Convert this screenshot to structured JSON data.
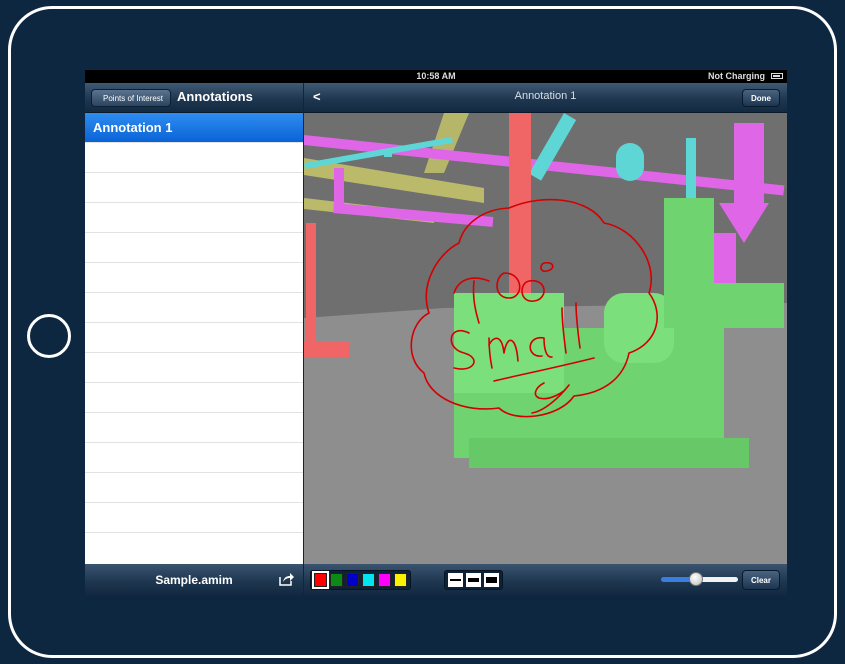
{
  "status": {
    "time": "10:58 AM",
    "charging": "Not Charging"
  },
  "master": {
    "back_label": "Points of Interest",
    "title": "Annotations",
    "items": [
      {
        "label": "Annotation 1",
        "selected": true
      }
    ],
    "empty_rows": 13,
    "file_name": "Sample.amim"
  },
  "detail": {
    "back_label": "<",
    "title": "Annotation 1",
    "done_label": "Done",
    "annotation_text": "Too small"
  },
  "toolbar": {
    "colors": [
      "#ff0000",
      "#0b8a16",
      "#0000c8",
      "#00e5f0",
      "#ff00ff",
      "#f8f200"
    ],
    "selected_color": "#ff0000",
    "line_widths": [
      "thin",
      "medium",
      "thick"
    ],
    "brush_size": 0.46,
    "clear_label": "Clear"
  },
  "icons": {
    "share": "share-icon",
    "battery": "battery-icon"
  }
}
